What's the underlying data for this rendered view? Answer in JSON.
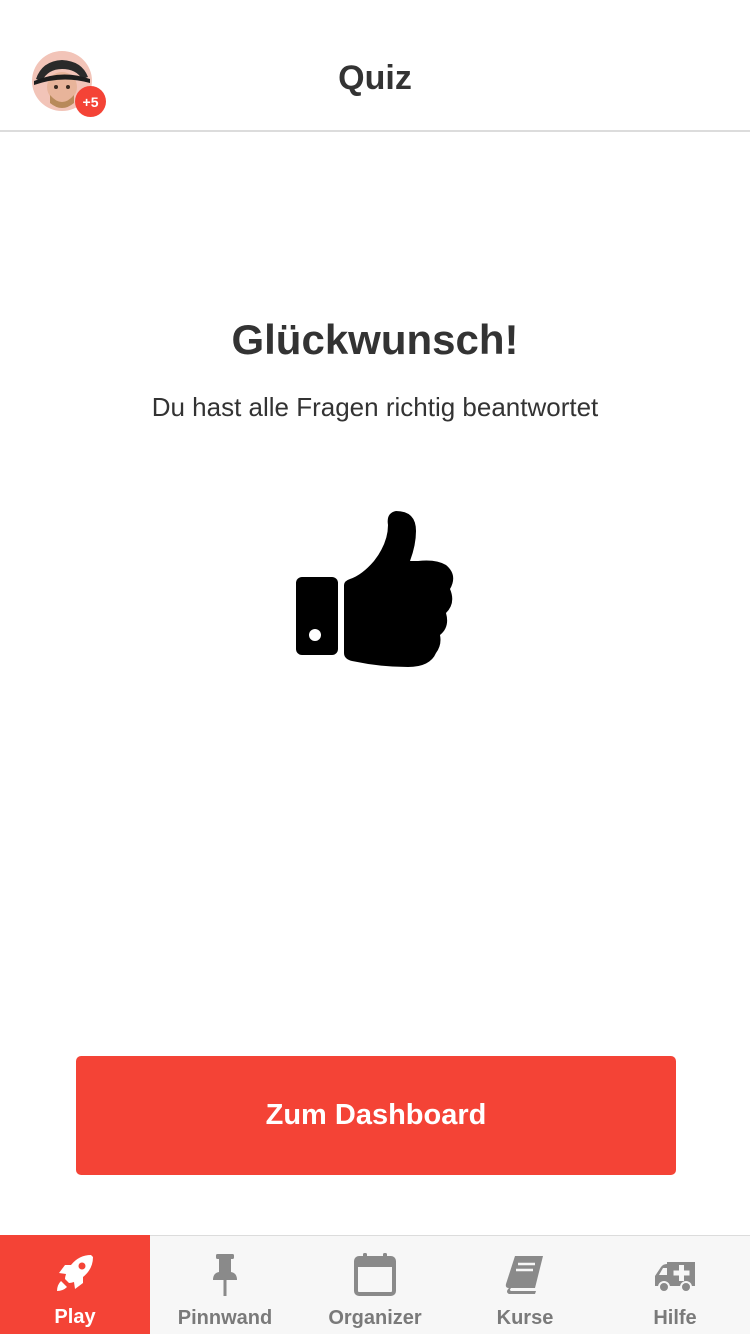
{
  "header": {
    "title": "Quiz",
    "avatar_badge": "+5"
  },
  "main": {
    "heading": "Glückwunsch!",
    "subtitle": "Du hast alle Fragen richtig beantwortet",
    "icon": "thumbs-up-icon"
  },
  "cta": {
    "label": "Zum Dashboard"
  },
  "tabbar": {
    "items": [
      {
        "label": "Play",
        "icon": "rocket-icon",
        "active": true
      },
      {
        "label": "Pinnwand",
        "icon": "pushpin-icon",
        "active": false
      },
      {
        "label": "Organizer",
        "icon": "calendar-icon",
        "active": false
      },
      {
        "label": "Kurse",
        "icon": "book-icon",
        "active": false
      },
      {
        "label": "Hilfe",
        "icon": "ambulance-icon",
        "active": false
      }
    ]
  },
  "colors": {
    "accent": "#f44336",
    "text": "#333333",
    "tab_inactive": "#7a7a7a",
    "tabbar_bg": "#f7f7f7"
  }
}
